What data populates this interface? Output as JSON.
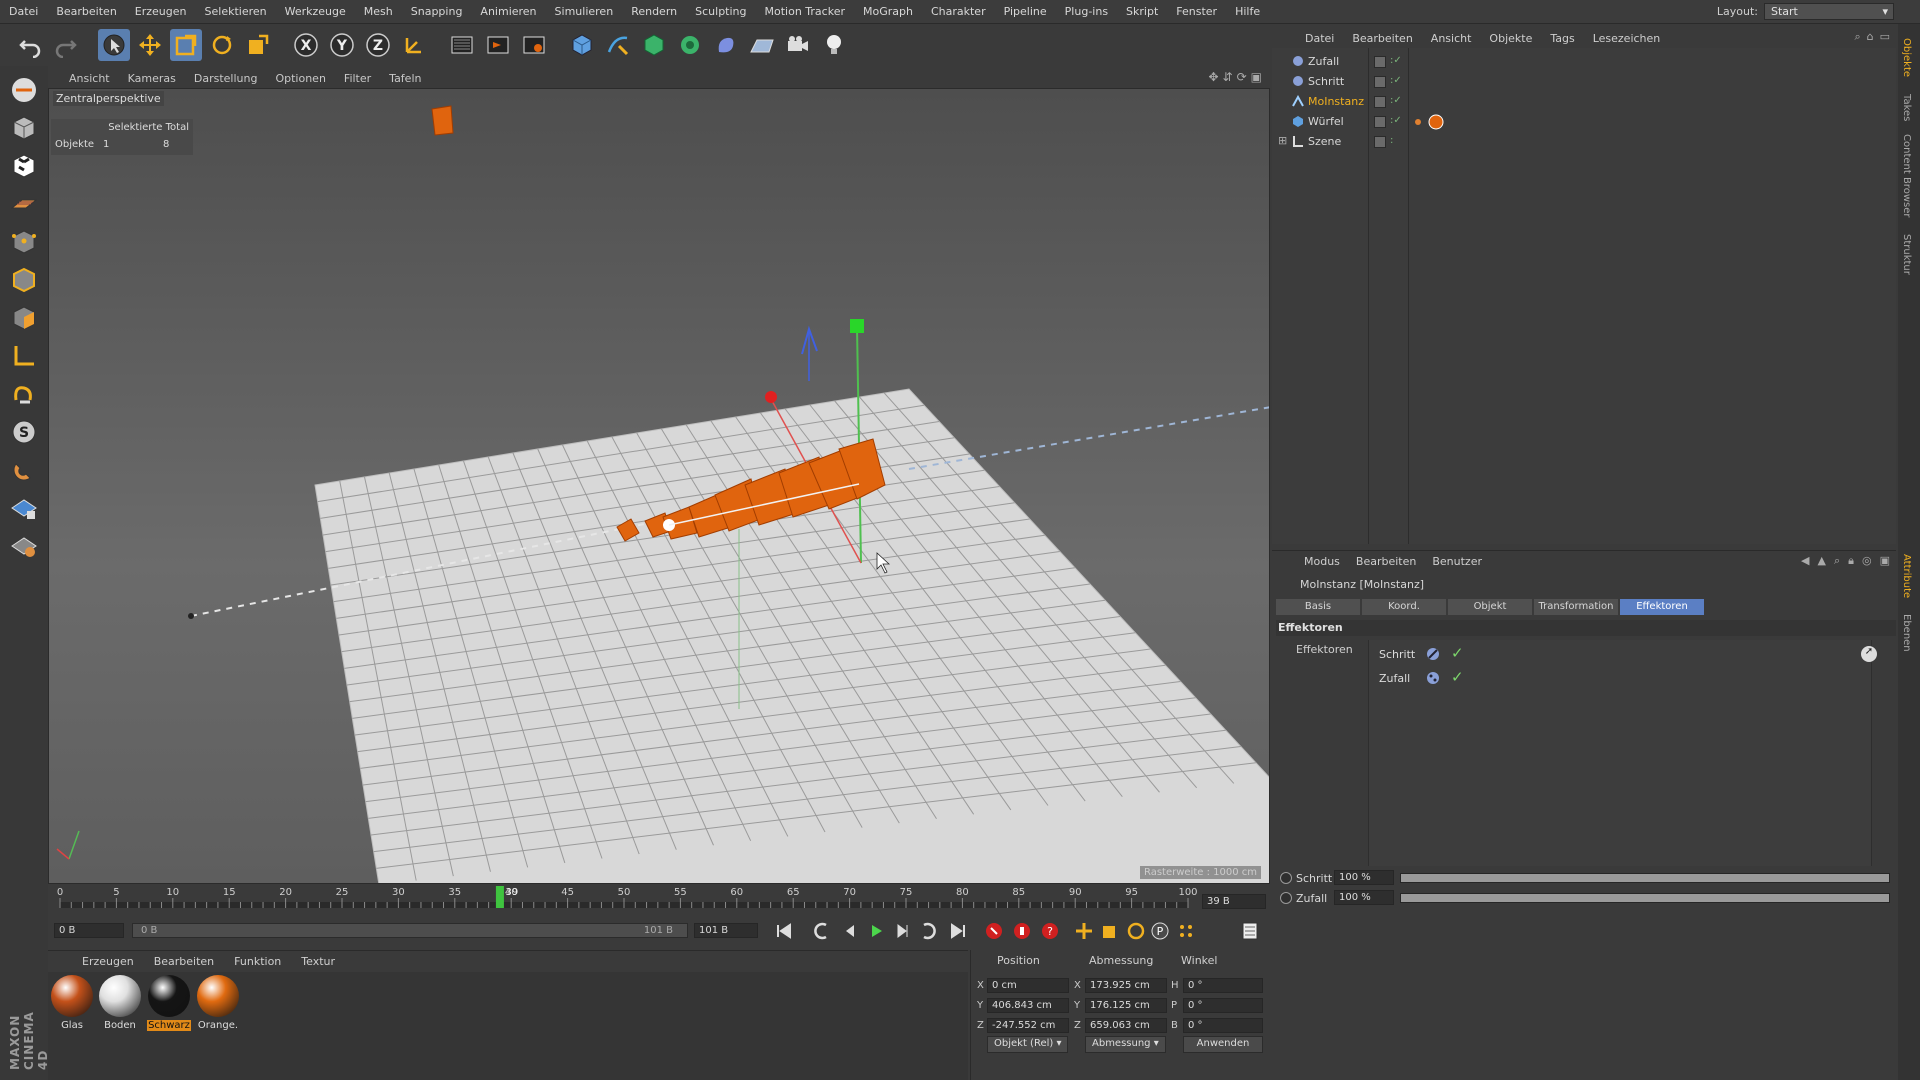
{
  "menubar": {
    "items": [
      "Datei",
      "Bearbeiten",
      "Erzeugen",
      "Selektieren",
      "Werkzeuge",
      "Mesh",
      "Snapping",
      "Animieren",
      "Simulieren",
      "Rendern",
      "Sculpting",
      "Motion Tracker",
      "MoGraph",
      "Charakter",
      "Pipeline",
      "Plug-ins",
      "Skript",
      "Fenster",
      "Hilfe"
    ],
    "layout_label": "Layout:",
    "layout_value": "Start"
  },
  "toolbar": {
    "icons": [
      "undo-icon",
      "redo-icon",
      "select-icon",
      "move-icon",
      "scale-icon",
      "rotate-icon",
      "last-tool-icon",
      "x-axis-icon",
      "y-axis-icon",
      "z-axis-icon",
      "coordinate-system-icon",
      "render-view-icon",
      "render-picture-viewer-icon",
      "render-settings-icon",
      "cube-icon",
      "pen-icon",
      "subdivision-icon",
      "mograph-cloner-icon",
      "deformer-icon",
      "floor-icon",
      "camera-icon",
      "light-icon"
    ]
  },
  "viewport": {
    "menu": [
      "Ansicht",
      "Kameras",
      "Darstellung",
      "Optionen",
      "Filter",
      "Tafeln"
    ],
    "camera_label": "Zentralperspektive",
    "stats": {
      "header": "Selektierte Total",
      "label": "Objekte",
      "selected": "1",
      "total": "8"
    },
    "grid_spacing": "Rasterweite : 1000 cm"
  },
  "timeline": {
    "ticks": [
      "0",
      "5",
      "10",
      "15",
      "20",
      "25",
      "30",
      "35",
      "40",
      "45",
      "50",
      "55",
      "60",
      "65",
      "70",
      "75",
      "80",
      "85",
      "90",
      "95",
      "100"
    ],
    "current_frame": 39,
    "current_label": "39",
    "max_frame": 100,
    "frame_display": "39 B"
  },
  "transport": {
    "start_field": "0 B",
    "range_start": "0 B",
    "range_end": "101 B",
    "end_field": "101 B"
  },
  "materials": {
    "menu": [
      "Erzeugen",
      "Bearbeiten",
      "Funktion",
      "Textur"
    ],
    "items": [
      {
        "name": "Glas",
        "color": "#c4511a"
      },
      {
        "name": "Boden",
        "color": "#e0e0e0"
      },
      {
        "name": "Schwarz",
        "color": "#151515"
      },
      {
        "name": "Orange.",
        "color": "#e06a10"
      }
    ],
    "selected_index": 2
  },
  "coords": {
    "headers": [
      "Position",
      "Abmessung",
      "Winkel"
    ],
    "rows": [
      {
        "axis": "X",
        "pos": "0 cm",
        "size_axis": "X",
        "size": "173.925 cm",
        "rot_axis": "H",
        "rot": "0 °"
      },
      {
        "axis": "Y",
        "pos": "406.843 cm",
        "size_axis": "Y",
        "size": "176.125 cm",
        "rot_axis": "P",
        "rot": "0 °"
      },
      {
        "axis": "Z",
        "pos": "-247.552 cm",
        "size_axis": "Z",
        "size": "659.063 cm",
        "rot_axis": "B",
        "rot": "0 °"
      }
    ],
    "mode1": "Objekt (Rel)",
    "mode2": "Abmessung",
    "apply": "Anwenden"
  },
  "object_manager": {
    "menu": [
      "Datei",
      "Bearbeiten",
      "Ansicht",
      "Objekte",
      "Tags",
      "Lesezeichen"
    ],
    "objects": [
      {
        "name": "Zufall",
        "highlight": false
      },
      {
        "name": "Schritt",
        "highlight": false
      },
      {
        "name": "MoInstanz",
        "highlight": true
      },
      {
        "name": "Würfel",
        "highlight": false
      },
      {
        "name": "Szene",
        "highlight": false
      }
    ]
  },
  "attributes": {
    "menu": [
      "Modus",
      "Bearbeiten",
      "Benutzer"
    ],
    "title": "MoInstanz [MoInstanz]",
    "tabs": [
      "Basis",
      "Koord.",
      "Objekt",
      "Transformation",
      "Effektoren"
    ],
    "active_tab": "Effektoren",
    "section": "Effektoren",
    "field_label": "Effektoren",
    "effectors": [
      "Schritt",
      "Zufall"
    ],
    "strengths": [
      {
        "name": "Schritt",
        "value": "100 %",
        "fraction": 1.0
      },
      {
        "name": "Zufall",
        "value": "100 %",
        "fraction": 1.0
      }
    ]
  },
  "side_tabs": [
    "Objekte",
    "Takes",
    "Content Browser",
    "Struktur",
    "Attribute",
    "Ebenen"
  ],
  "colors": {
    "accent_blue": "#5b7fc4",
    "object_orange": "#e0640e",
    "highlight_yellow": "#f0b020",
    "check_green": "#7cd66b"
  }
}
